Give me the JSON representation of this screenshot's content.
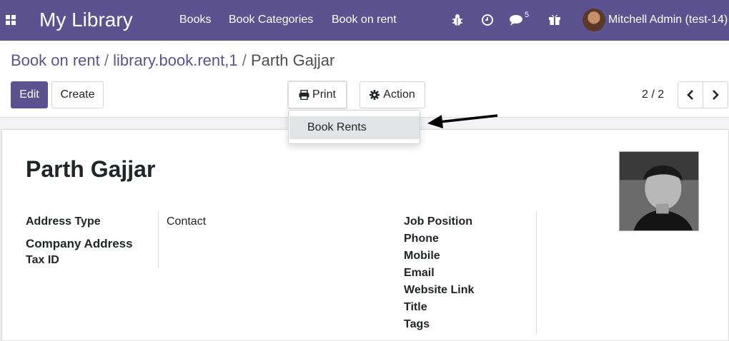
{
  "navbar": {
    "app_title": "My Library",
    "menu": [
      "Books",
      "Book Categories",
      "Book on rent"
    ],
    "messages_count": "5",
    "user": "Mitchell Admin (test-14)",
    "colors": {
      "brand": "#5b528f"
    }
  },
  "breadcrumb": {
    "items": [
      "Book on rent",
      "library.book.rent,1",
      "Parth Gajjar"
    ],
    "separator": "/"
  },
  "toolbar": {
    "edit_label": "Edit",
    "create_label": "Create",
    "print_label": "Print",
    "action_label": "Action"
  },
  "print_menu": {
    "items": [
      "Book Rents"
    ]
  },
  "pager": {
    "value": "2 / 2"
  },
  "form": {
    "name": "Parth Gajjar",
    "left_fields": [
      {
        "label": "Address Type",
        "value": "Contact"
      },
      {
        "label": "Company Address",
        "value": ""
      },
      {
        "label": "Tax ID",
        "value": ""
      }
    ],
    "right_fields": [
      {
        "label": "Job Position"
      },
      {
        "label": "Phone"
      },
      {
        "label": "Mobile"
      },
      {
        "label": "Email"
      },
      {
        "label": "Website Link"
      },
      {
        "label": "Title"
      },
      {
        "label": "Tags"
      }
    ]
  },
  "icons": {
    "apps": "apps-grid-icon",
    "bug": "bug-icon",
    "clock": "clock-icon",
    "chat": "chat-icon",
    "gift": "gift-icon",
    "print": "print-icon",
    "action": "gear-icon",
    "prev": "chevron-left-icon",
    "next": "chevron-right-icon"
  }
}
